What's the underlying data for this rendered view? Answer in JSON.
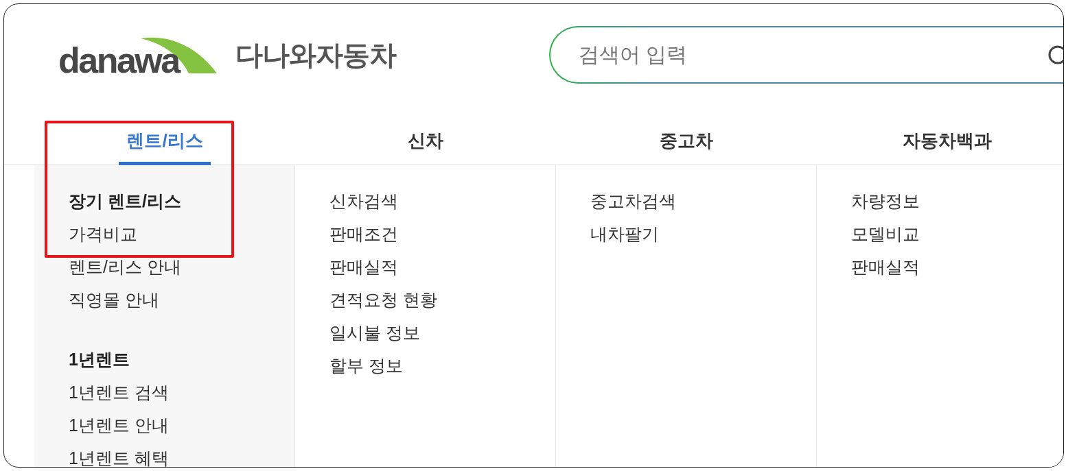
{
  "logo": {
    "wordmark": "danawa",
    "title": "다나와자동차"
  },
  "search": {
    "placeholder": "검색어 입력"
  },
  "menu": [
    {
      "label": "렌트/리스",
      "selected": true,
      "groups": [
        {
          "heading": "장기 렌트/리스",
          "items": [
            "가격비교",
            "렌트/리스 안내",
            "직영몰 안내"
          ]
        },
        {
          "heading": "1년렌트",
          "items": [
            "1년렌트 검색",
            "1년렌트 안내",
            "1년렌트 혜택"
          ]
        }
      ]
    },
    {
      "label": "신차",
      "selected": false,
      "groups": [
        {
          "items": [
            "신차검색",
            "판매조건",
            "판매실적",
            "견적요청 현황",
            "일시불 정보",
            "할부 정보"
          ]
        }
      ]
    },
    {
      "label": "중고차",
      "selected": false,
      "groups": [
        {
          "items": [
            "중고차검색",
            "내차팔기"
          ]
        }
      ]
    },
    {
      "label": "자동차백과",
      "selected": false,
      "groups": [
        {
          "items": [
            "차량정보",
            "모델비교",
            "판매실적"
          ]
        }
      ]
    }
  ],
  "annotation": {
    "kind": "highlight-box"
  }
}
